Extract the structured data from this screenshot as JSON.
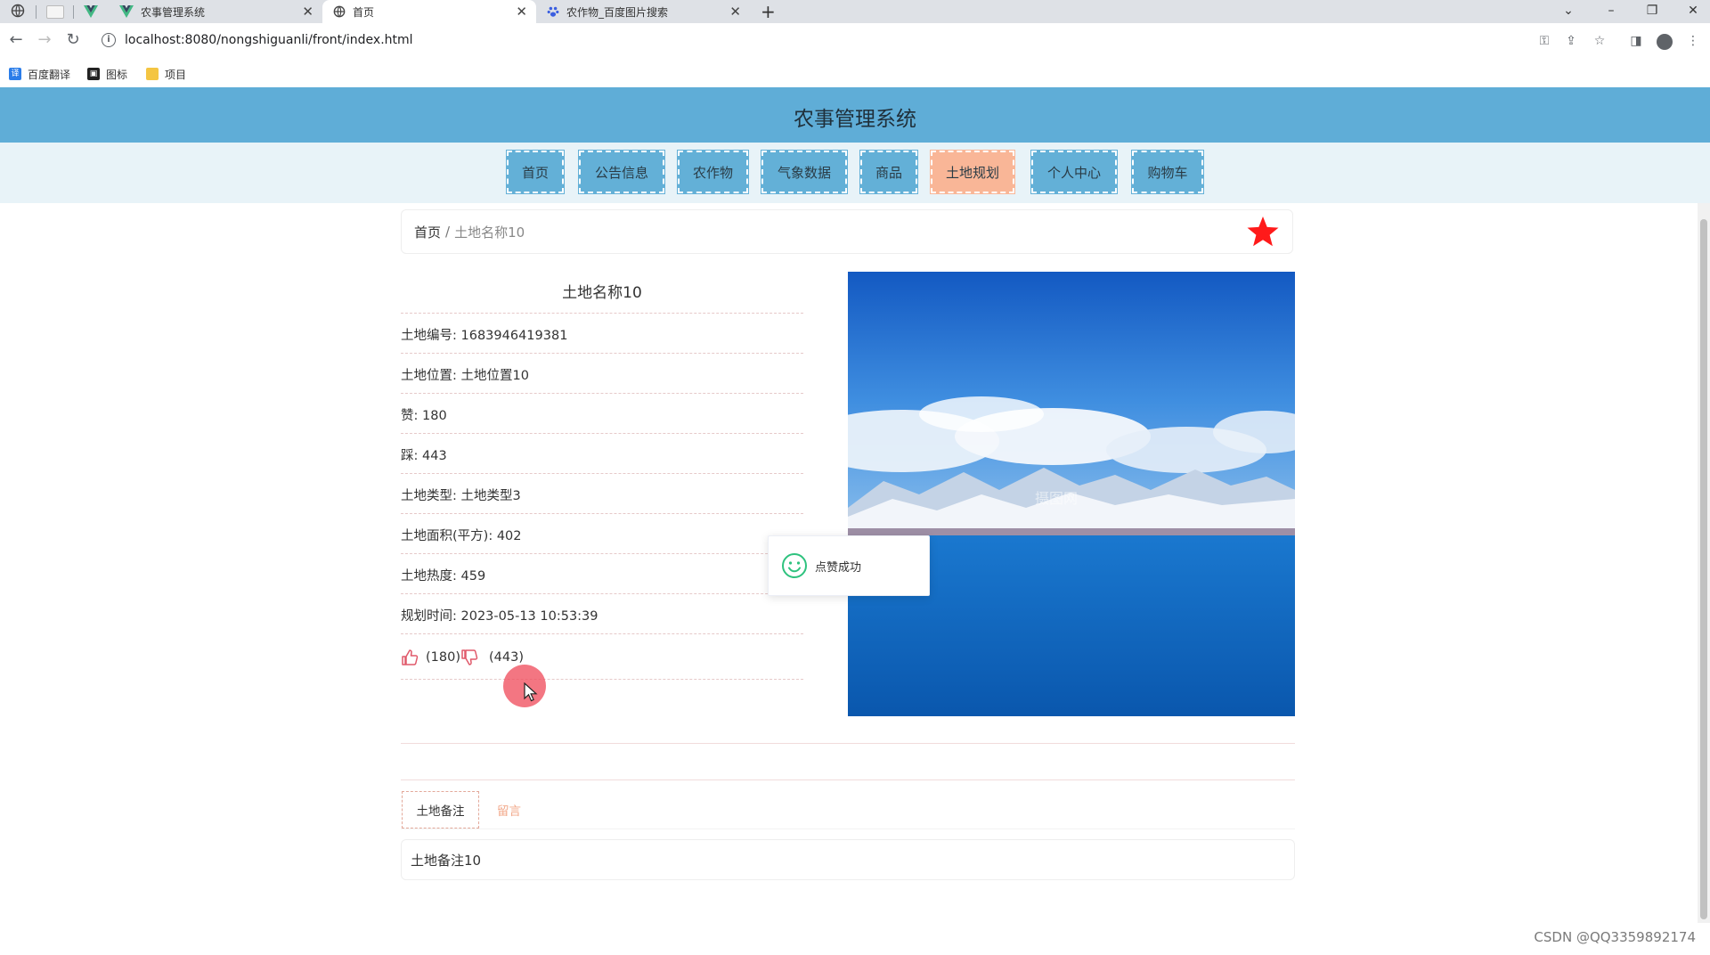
{
  "browser": {
    "tabs": [
      {
        "title": ""
      },
      {
        "title": "农事管理系统"
      },
      {
        "title": "首页"
      },
      {
        "title": "农作物_百度图片搜索"
      }
    ],
    "address": "localhost:8080/nongshiguanli/front/index.html",
    "bookmarks": [
      {
        "label": "百度翻译"
      },
      {
        "label": "图标"
      },
      {
        "label": "项目"
      }
    ]
  },
  "header": {
    "title": "农事管理系统"
  },
  "nav": {
    "items": [
      "首页",
      "公告信息",
      "农作物",
      "气象数据",
      "商品",
      "土地规划",
      "个人中心",
      "购物车"
    ],
    "active_index": 5,
    "active_color": "#f9b697",
    "color": "#63b0d7"
  },
  "breadcrumb": {
    "home": "首页",
    "separator": "/",
    "current": "土地名称10"
  },
  "detail": {
    "title": "土地名称10",
    "fields": [
      {
        "label": "土地编号:",
        "value": "1683946419381"
      },
      {
        "label": "土地位置:",
        "value": "土地位置10"
      },
      {
        "label": "赞:",
        "value": "180"
      },
      {
        "label": "踩:",
        "value": "443"
      },
      {
        "label": "土地类型:",
        "value": "土地类型3"
      },
      {
        "label": "土地面积(平方):",
        "value": "402"
      },
      {
        "label": "土地热度:",
        "value": "459"
      },
      {
        "label": "规划时间:",
        "value": "2023-05-13 10:53:39"
      }
    ],
    "like_count": "(180)",
    "dislike_count": "(443)",
    "image_watermark": "摄图网"
  },
  "toast": {
    "message": "点赞成功"
  },
  "tabs": {
    "items": [
      "土地备注",
      "留言"
    ]
  },
  "note": {
    "content": "土地备注10"
  },
  "watermark": "CSDN @QQ3359892174"
}
